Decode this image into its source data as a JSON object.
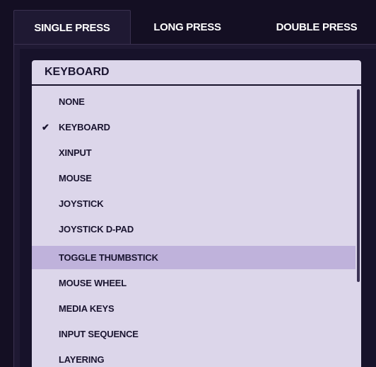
{
  "tabs": [
    {
      "label": "SINGLE PRESS",
      "active": true
    },
    {
      "label": "LONG PRESS",
      "active": false
    },
    {
      "label": "DOUBLE PRESS",
      "active": false
    }
  ],
  "select": {
    "value": "KEYBOARD"
  },
  "dropdown": {
    "options": [
      {
        "label": "NONE"
      },
      {
        "label": "KEYBOARD",
        "checked": true
      },
      {
        "label": "XINPUT"
      },
      {
        "label": "MOUSE"
      },
      {
        "label": "JOYSTICK"
      },
      {
        "label": "JOYSTICK D-PAD"
      },
      {
        "label": "TOGGLE THUMBSTICK",
        "hovered": true
      },
      {
        "label": "MOUSE WHEEL"
      },
      {
        "label": "MEDIA KEYS"
      },
      {
        "label": "INPUT SEQUENCE"
      },
      {
        "label": "LAYERING"
      }
    ],
    "check_glyph": "✔"
  },
  "colors": {
    "background": "#140f23",
    "panel": "#1f1933",
    "dropdown_bg": "#dcd6ea",
    "highlight": "#bfb2db",
    "text_dark": "#1a1530",
    "text_light": "#ffffff"
  }
}
